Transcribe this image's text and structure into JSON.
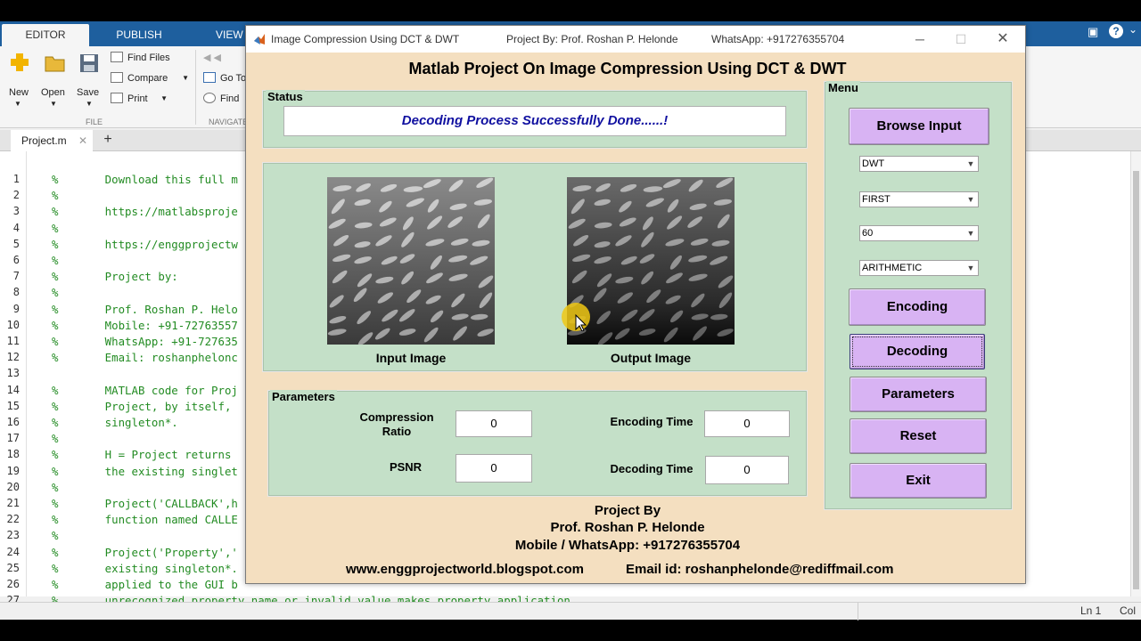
{
  "matlab": {
    "tabs": [
      "EDITOR",
      "PUBLISH",
      "VIEW"
    ],
    "ribbon": {
      "new": "New",
      "open": "Open",
      "save": "Save",
      "find_files": "Find Files",
      "compare": "Compare",
      "print": "Print",
      "go_to": "Go To",
      "find": "Find",
      "file_section": "FILE",
      "navigate_section": "NAVIGATE"
    },
    "file_tab": "Project.m",
    "line_numbers": [
      "1",
      "2",
      "3",
      "4",
      "5",
      "6",
      "7",
      "8",
      "9",
      "10",
      "11",
      "12",
      "13",
      "14",
      "15",
      "16",
      "17",
      "18",
      "19",
      "20",
      "21",
      "22",
      "23",
      "24",
      "25",
      "26",
      "27"
    ],
    "code_lines": [
      "%       Download this full m",
      "%",
      "%       https://matlabsproje",
      "%",
      "%       https://enggprojectw",
      "%",
      "%       Project by:",
      "%",
      "%       Prof. Roshan P. Helo",
      "%       Mobile: +91-72763557",
      "%       WhatsApp: +91-727635",
      "%       Email: roshanphelonc",
      "",
      "%       MATLAB code for Proj",
      "%       Project, by itself,",
      "%       singleton*.",
      "%",
      "%       H = Project returns",
      "%       the existing singlet",
      "%",
      "%       Project('CALLBACK',h",
      "%       function named CALLE",
      "%",
      "%       Project('Property','",
      "%       existing singleton*.",
      "%       applied to the GUI b",
      "%       unrecognized property name or invalid value makes property application"
    ],
    "status_ln": "Ln   1",
    "status_col": "Col"
  },
  "figure": {
    "window_title": "Image Compression Using DCT & DWT",
    "title_project_by": "Project By: Prof. Roshan P. Helonde",
    "title_whatsapp": "WhatsApp: +917276355704",
    "main_title": "Matlab Project On Image Compression Using DCT & DWT",
    "status": {
      "label": "Status",
      "message": "Decoding Process Successfully Done......!"
    },
    "images": {
      "input_label": "Input Image",
      "output_label": "Output Image"
    },
    "parameters": {
      "label": "Parameters",
      "compression_ratio_label": "Compression Ratio",
      "compression_ratio_value": "0",
      "psnr_label": "PSNR",
      "psnr_value": "0",
      "encoding_time_label": "Encoding Time",
      "encoding_time_value": "0",
      "decoding_time_label": "Decoding Time",
      "decoding_time_value": "0"
    },
    "menu": {
      "label": "Menu",
      "browse_input": "Browse Input",
      "method_select": "DWT",
      "level_select": "FIRST",
      "quality_select": "60",
      "coding_select": "ARITHMETIC",
      "encoding": "Encoding",
      "decoding": "Decoding",
      "parameters": "Parameters",
      "reset": "Reset",
      "exit": "Exit"
    },
    "footer": {
      "project_by": "Project By",
      "name": "Prof. Roshan P. Helonde",
      "mobile": "Mobile / WhatsApp: +917276355704",
      "website": "www.enggprojectworld.blogspot.com",
      "email": "Email id: roshanphelonde@rediffmail.com"
    }
  },
  "colors": {
    "figure_bg": "#f4dfc0",
    "panel_bg": "#c4e0c8",
    "button_bg": "#d8b3f3",
    "status_text": "#1010a0",
    "ribbon_blue": "#1e5f9e"
  }
}
